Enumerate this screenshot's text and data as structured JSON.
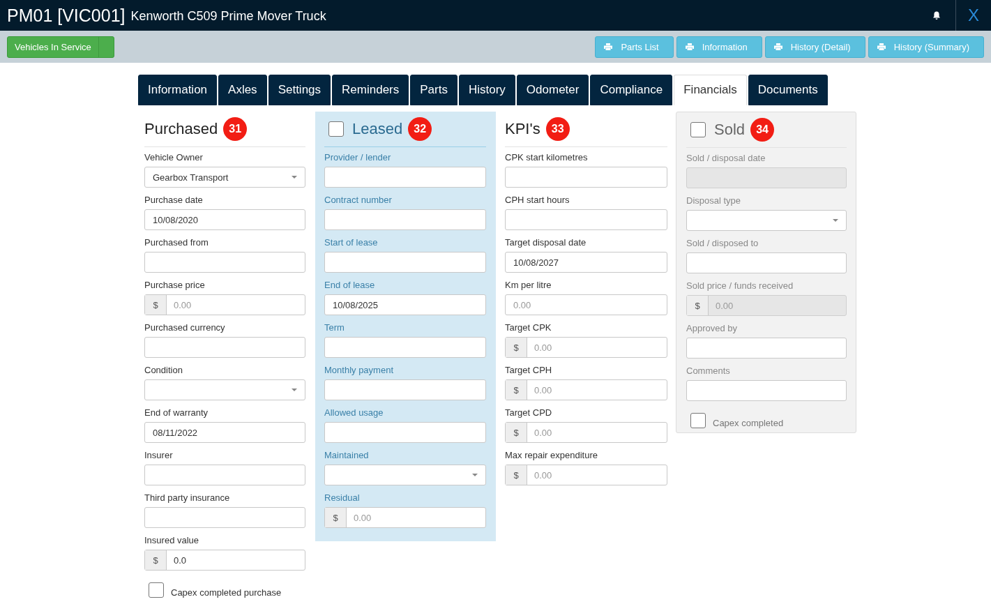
{
  "header": {
    "code": "PM01 [VIC001]",
    "title": "Kenworth C509 Prime Mover Truck",
    "close": "X"
  },
  "toolbar": {
    "status_button": "Vehicles In Service",
    "print_buttons": [
      "Parts List",
      "Information",
      "History (Detail)",
      "History (Summary)"
    ]
  },
  "tabs": [
    {
      "label": "Information",
      "selected": false
    },
    {
      "label": "Axles",
      "selected": false
    },
    {
      "label": "Settings",
      "selected": false
    },
    {
      "label": "Reminders",
      "selected": false
    },
    {
      "label": "Parts",
      "selected": false
    },
    {
      "label": "History",
      "selected": false
    },
    {
      "label": "Odometer",
      "selected": false
    },
    {
      "label": "Compliance",
      "selected": false
    },
    {
      "label": "Financials",
      "selected": true
    },
    {
      "label": "Documents",
      "selected": false
    }
  ],
  "sections": [
    {
      "kind": "plain",
      "title": "Purchased",
      "badge": "31",
      "fields": [
        {
          "kind": "select",
          "label": "Vehicle Owner",
          "value": "Gearbox Transport",
          "disabled": false
        },
        {
          "kind": "text",
          "label": "Purchase date",
          "value": "10/08/2020",
          "disabled": false
        },
        {
          "kind": "text",
          "label": "Purchased from",
          "disabled": false
        },
        {
          "kind": "money",
          "label": "Purchase price",
          "prefix": "$",
          "placeholder": "0.00",
          "disabled": false
        },
        {
          "kind": "text",
          "label": "Purchased currency",
          "disabled": false
        },
        {
          "kind": "select",
          "label": "Condition",
          "disabled": false
        },
        {
          "kind": "text",
          "label": "End of warranty",
          "value": "08/11/2022",
          "disabled": false
        },
        {
          "kind": "text",
          "label": "Insurer",
          "disabled": false
        },
        {
          "kind": "text",
          "label": "Third party insurance",
          "disabled": false
        },
        {
          "kind": "money",
          "label": "Insured value",
          "prefix": "$",
          "value": "0.0",
          "disabled": false
        },
        {
          "kind": "checkbox",
          "label": "Capex completed purchase",
          "checked": false
        }
      ]
    },
    {
      "kind": "leased",
      "title": "Leased",
      "badge": "32",
      "checked": false,
      "fields": [
        {
          "kind": "text",
          "label": "Provider / lender",
          "disabled": false
        },
        {
          "kind": "text",
          "label": "Contract number",
          "disabled": false
        },
        {
          "kind": "text",
          "label": "Start of lease",
          "disabled": false
        },
        {
          "kind": "text",
          "label": "End of lease",
          "value": "10/08/2025",
          "disabled": false
        },
        {
          "kind": "text",
          "label": "Term",
          "disabled": false
        },
        {
          "kind": "text",
          "label": "Monthly payment",
          "disabled": false
        },
        {
          "kind": "text",
          "label": "Allowed usage",
          "disabled": false
        },
        {
          "kind": "select",
          "label": "Maintained",
          "disabled": false
        },
        {
          "kind": "money",
          "label": "Residual",
          "prefix": "$",
          "placeholder": "0.00",
          "disabled": false
        }
      ]
    },
    {
      "kind": "plain",
      "title": "KPI's",
      "badge": "33",
      "fields": [
        {
          "kind": "text",
          "label": "CPK start kilometres",
          "disabled": false
        },
        {
          "kind": "text",
          "label": "CPH start hours",
          "disabled": false
        },
        {
          "kind": "text",
          "label": "Target disposal date",
          "value": "10/08/2027",
          "disabled": false
        },
        {
          "kind": "text",
          "label": "Km per litre",
          "placeholder": "0.00",
          "disabled": false
        },
        {
          "kind": "money",
          "label": "Target CPK",
          "prefix": "$",
          "placeholder": "0.00",
          "disabled": false
        },
        {
          "kind": "money",
          "label": "Target CPH",
          "prefix": "$",
          "placeholder": "0.00",
          "disabled": false
        },
        {
          "kind": "money",
          "label": "Target CPD",
          "prefix": "$",
          "placeholder": "0.00",
          "disabled": false
        },
        {
          "kind": "money",
          "label": "Max repair expenditure",
          "prefix": "$",
          "placeholder": "0.00",
          "disabled": false
        }
      ]
    },
    {
      "kind": "sold",
      "title": "Sold",
      "badge": "34",
      "checked": false,
      "fields": [
        {
          "kind": "text",
          "label": "Sold / disposal date",
          "disabled": true
        },
        {
          "kind": "select",
          "label": "Disposal type",
          "disabled": false
        },
        {
          "kind": "text",
          "label": "Sold / disposed to",
          "disabled": false
        },
        {
          "kind": "money",
          "label": "Sold price / funds received",
          "prefix": "$",
          "placeholder": "0.00",
          "disabled": true
        },
        {
          "kind": "text",
          "label": "Approved by",
          "disabled": false
        },
        {
          "kind": "text",
          "label": "Comments",
          "disabled": false
        },
        {
          "kind": "checkbox",
          "label": "Capex completed",
          "checked": false
        }
      ]
    }
  ]
}
